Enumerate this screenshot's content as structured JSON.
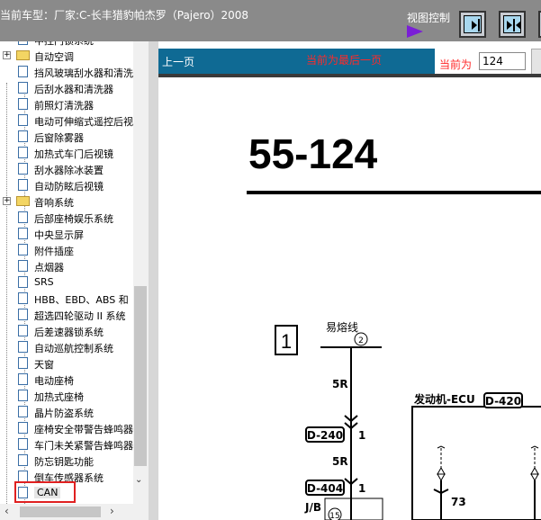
{
  "header": {
    "title": "当前车型：厂家:C-长丰猎豹帕杰罗（Pajero）2008",
    "view_control_label": "视图控制"
  },
  "tree": {
    "items": [
      {
        "type": "doc",
        "label": "中控门锁系统"
      },
      {
        "type": "folder",
        "label": "自动空调"
      },
      {
        "type": "doc",
        "label": "挡风玻璃刮水器和清洗"
      },
      {
        "type": "doc",
        "label": "后刮水器和清洗器"
      },
      {
        "type": "doc",
        "label": "前照灯清洗器"
      },
      {
        "type": "doc",
        "label": "电动可伸缩式遥控后视"
      },
      {
        "type": "doc",
        "label": "后窗除雾器"
      },
      {
        "type": "doc",
        "label": "加热式车门后视镜"
      },
      {
        "type": "doc",
        "label": "刮水器除冰装置"
      },
      {
        "type": "doc",
        "label": "自动防眩后视镜"
      },
      {
        "type": "folder",
        "label": "音响系统"
      },
      {
        "type": "doc",
        "label": "后部座椅娱乐系统"
      },
      {
        "type": "doc",
        "label": "中央显示屏"
      },
      {
        "type": "doc",
        "label": "附件插座"
      },
      {
        "type": "doc",
        "label": "点烟器"
      },
      {
        "type": "doc",
        "label": "SRS"
      },
      {
        "type": "doc",
        "label": "HBB、EBD、ABS 和"
      },
      {
        "type": "doc",
        "label": "超选四轮驱动 II 系统"
      },
      {
        "type": "doc",
        "label": "后差速器锁系统"
      },
      {
        "type": "doc",
        "label": "自动巡航控制系统"
      },
      {
        "type": "doc",
        "label": "天窗"
      },
      {
        "type": "doc",
        "label": "电动座椅"
      },
      {
        "type": "doc",
        "label": "加热式座椅"
      },
      {
        "type": "doc",
        "label": "晶片防盗系统"
      },
      {
        "type": "doc",
        "label": "座椅安全带警告蜂鸣器"
      },
      {
        "type": "doc",
        "label": "车门未关紧警告蜂鸣器"
      },
      {
        "type": "doc",
        "label": "防忘钥匙功能"
      },
      {
        "type": "doc",
        "label": "倒车传感器系统"
      },
      {
        "type": "doc",
        "label": "CAN"
      }
    ]
  },
  "nav": {
    "prev_label": "上一页",
    "last_page_msg": "当前为最后一页",
    "current_label": "当前为",
    "current_page": "124"
  },
  "diagram": {
    "page_number": "55-124",
    "section_number": "1",
    "fuse_label": "易熔线",
    "fuse_num": "2",
    "wire1": "5R",
    "wire2": "5R",
    "conn1": "D-240",
    "conn1_pin": "1",
    "conn2": "D-404",
    "conn2_pin": "1",
    "jb_label": "J/B",
    "jb_num": "15",
    "ecu_label": "发动机-ECU",
    "ecu_conn": "D-420",
    "ecu_pin": "73"
  }
}
